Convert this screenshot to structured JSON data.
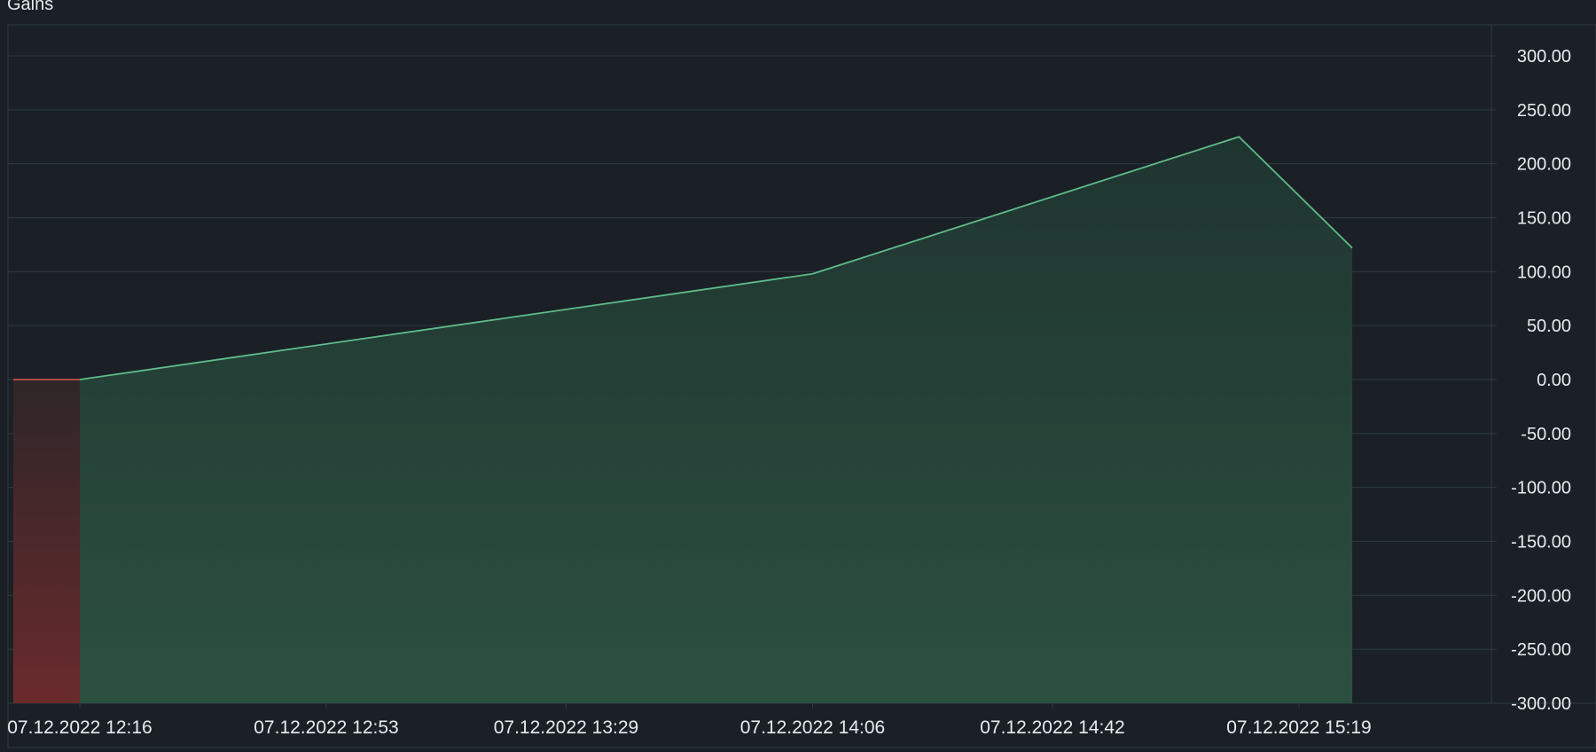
{
  "chart_data": {
    "type": "area",
    "title": "Gains",
    "xlabel": "",
    "ylabel": "",
    "ylim": [
      -300,
      300
    ],
    "yticks": [
      300,
      250,
      200,
      150,
      100,
      50,
      0,
      -50,
      -100,
      -150,
      -200,
      -250,
      -300
    ],
    "ytick_labels": [
      "300.00",
      "250.00",
      "200.00",
      "150.00",
      "100.00",
      "50.00",
      "0.00",
      "-50.00",
      "-100.00",
      "-150.00",
      "-200.00",
      "-250.00",
      "-300.00"
    ],
    "xtick_labels": [
      "07.12.2022 12:16",
      "07.12.2022 12:53",
      "07.12.2022 13:29",
      "07.12.2022 14:06",
      "07.12.2022 14:42",
      "07.12.2022 15:19"
    ],
    "x": [
      "07.12.2022 12:06",
      "07.12.2022 12:16",
      "07.12.2022 14:06",
      "07.12.2022 15:10",
      "07.12.2022 15:27"
    ],
    "series": [
      {
        "values": [
          0,
          0,
          98,
          225,
          122
        ]
      }
    ],
    "negative_segment": {
      "from": "07.12.2022 12:06",
      "to": "07.12.2022 12:16",
      "value": 0
    },
    "grid": true,
    "legend": "none",
    "colors": {
      "background": "#1a2026",
      "grid": "#2e3a42",
      "line": "#5fbb8a",
      "fill_top": "#203630",
      "fill_bottom": "#2c5040",
      "negative_line": "#e0564e",
      "negative_fill_top": "#302628",
      "negative_fill_bottom": "#6a2a2c",
      "text": "#e8ebee"
    }
  }
}
